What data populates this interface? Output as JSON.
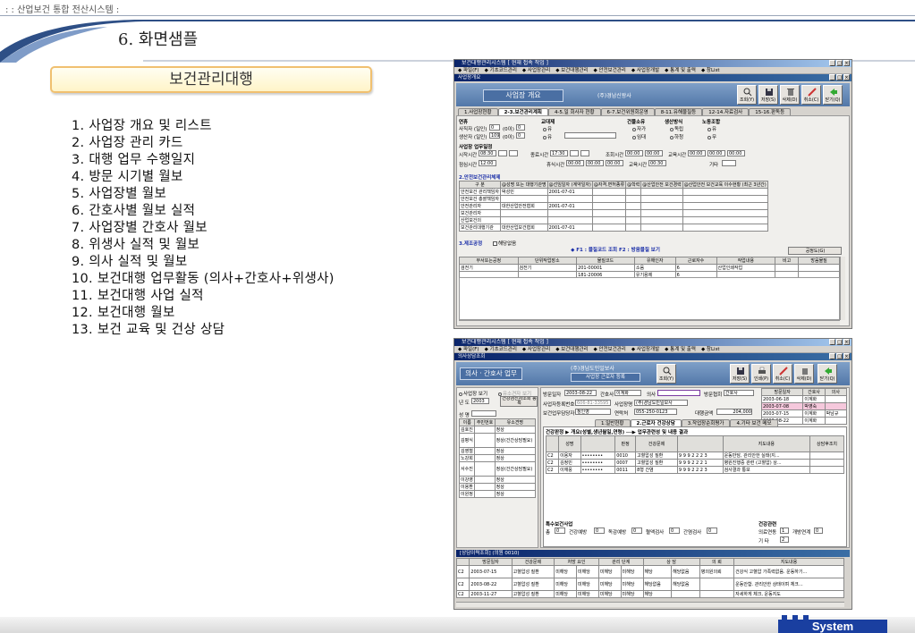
{
  "header": {
    "system_title": ": : 산업보건 통합 전산시스템 :",
    "page_title": "6. 화면샘플"
  },
  "section": {
    "title": "보건관리대행"
  },
  "toc": [
    "1. 사업장 개요 및 리스트",
    "2. 사업장 관리 카드",
    "3. 대행 업무 수행일지",
    "4. 방문 시기별 월보",
    "5. 사업장별 월보",
    "6. 간호사별 월보 실적",
    "7. 사업장별 간호사 월보",
    "8. 위생사 실적 및 월보",
    "9. 의사 실적 및 월보",
    "10. 보건대행 업무활동 (의사+간호사+위생사)",
    "11. 보건대행 사업 실적",
    "12. 보건대행 월보",
    "13. 보건 교육 및 건상 상담"
  ],
  "footer": {
    "logo_text": "System"
  },
  "window1": {
    "title": "보건대행관리시스템 [ 현재 접속 작업 ]",
    "menu": [
      "◆ 파일(F)",
      "◆ 기초코드관리",
      "◆ 사업장관리",
      "◆ 보건대행관리",
      "◆ 안전보건관리",
      "◆ 사업장개발",
      "◆ 통계 및 출력",
      "◆ 창List"
    ],
    "subwindow_title": "사업장개요",
    "header_title": "사업장 개요",
    "company": "(주)경남신왕사",
    "buttons": [
      "조회(Y)",
      "저장(S)",
      "삭제(D)",
      "취소(C)",
      "닫기(Q)"
    ],
    "tabs": [
      "1.사업장현황",
      "2-3.보건관리계획",
      "4-5.일 회사자 현황",
      "6-7.보건위원회운영",
      "8-11.유해물질등",
      "12-14.자료검사",
      "15-16.판독등"
    ],
    "active_tab": "2-3.보건관리계획",
    "sec_yeonhyu": "연휴",
    "sec_gyodae": "교대제",
    "sec_geonmul": "건물소유",
    "sec_saengsan": "생산방식",
    "sec_nojo": "노동조합",
    "row_saryeon": "사직자 (일인)",
    "row_saengsan": "생산자 (일인)",
    "val_saryeon": "0",
    "val_saengsan": "109",
    "unit": "(0이)",
    "unit_val": "0",
    "gyodae_opts": [
      "유",
      "유"
    ],
    "geonmul_opts": [
      "자가",
      "임대"
    ],
    "saengsan_opts": [
      "독립",
      "하청"
    ],
    "nojo_opts": [
      "유",
      "무"
    ],
    "work_time_title": "사업장 업무일정",
    "time_labels": [
      "시작시간",
      "종료시간",
      "조회시간",
      "교육시간",
      "점심시간",
      "휴식시간",
      "교육시간",
      "기타"
    ],
    "time_values": [
      "08:30",
      "17:30",
      "00:00",
      "00:00",
      "12:00",
      "00:00",
      "00:30"
    ],
    "mgmt_title": "2.안전보건관리체제",
    "mgmt_headers": [
      "구 분",
      "@성명 또는 대행기관명",
      "@선임일자 (계약일자)",
      "@자격.면허종류",
      "@학력",
      "@산업안전 보건경력",
      "@산업안전 보건교육 이수현황 (최근 3년간)",
      "교육과정명",
      "교육기간"
    ],
    "mgmt_rows": [
      [
        "안전보건 관리책임자",
        "박성민",
        "2001-07-01"
      ],
      [
        "안전보건 총괄책임자",
        "",
        ""
      ],
      [
        "안전관리자",
        "대한산업안전협회",
        "2001-07-01"
      ],
      [
        "보건관리자",
        "",
        ""
      ],
      [
        "산업보건의",
        "",
        ""
      ],
      [
        "보건관리대행기관",
        "대한산업보건협회",
        "2001-07-01"
      ]
    ],
    "process_title": "3.제조공정",
    "process_check": "해당없음",
    "process_bar": "◆ F1 : 물질코드 조회   F2 : 방음물질 보기",
    "process_btn": "공정도(G)",
    "proc_headers": [
      "부서또는공정",
      "단위작업장소",
      "물질코드",
      "유해인자",
      "근로자수",
      "작업내용",
      "비고",
      "방음물질"
    ],
    "proc_rows": [
      [
        "검전기",
        "검전기",
        "201-00001",
        "소음",
        "6",
        "산업인쇄작업"
      ],
      [
        "",
        "",
        "181-20006",
        "유기용제",
        "6",
        ""
      ]
    ]
  },
  "window2": {
    "title": "보건대행관리시스템 [ 현재 접속 작업 ]",
    "menu": [
      "◆ 파일(F)",
      "◆ 기초코드관리",
      "◆ 사업장관리",
      "◆ 보건대행관리",
      "◆ 안전보건관리",
      "◆ 사업장개발",
      "◆ 통계 및 출력",
      "◆ 창List"
    ],
    "subwindow_title": "의사상담조회",
    "header_title": "의사 · 간호사 업무",
    "company": "(주)경남도민일보사",
    "sub_header": "사업장 근로자 등록",
    "buttons": [
      "조회(Y)",
      "저장(S)",
      "인쇄(P)",
      "취소(C)",
      "삭제(D)",
      "닫기(Q)"
    ],
    "left_opts": [
      "사업장 보기",
      "유소견자 보기"
    ],
    "year_label": "년 도",
    "year_val": "2003",
    "check_btn": "건강검진자조회 등록",
    "name_label": "성 명",
    "left_headers": [
      "이름",
      "주민번호",
      "유소견명"
    ],
    "left_rows": [
      [
        "김호진",
        "정상"
      ],
      [
        "김평식",
        "정상(건간상담필요)"
      ],
      [
        "김영철",
        "정상"
      ],
      [
        "노강희",
        "정상"
      ],
      [
        "서수진",
        "정상(건간상담필요)"
      ],
      [
        "이강영",
        "정상"
      ],
      [
        "이용환",
        "정상"
      ],
      [
        "이원정",
        "정상"
      ]
    ],
    "visit_date_label": "방문일자",
    "visit_date": "2003-08-22",
    "nurse_label": "간호사",
    "nurse": "이계화",
    "doctor_label": "의사",
    "visitor_label": "방문협회",
    "visitor": "간호사",
    "biz_no_label": "사업자등록번호",
    "biz_no": "606-81-33595",
    "company_label": "사업장명",
    "company_val": "(주)경남도민일보사",
    "manager_label": "보건업무담당자",
    "manager": "정인영",
    "phone_label": "연락처",
    "phone": "055-250-0123",
    "count_label": "대행금액",
    "count": "204,000",
    "right_headers": [
      "방문일자",
      "간호사",
      "의사"
    ],
    "right_rows": [
      [
        "2003-06-18",
        "이계화",
        ""
      ],
      [
        "2003-07-08",
        "박영숙",
        ""
      ],
      [
        "2003-07-15",
        "이계화",
        "박남규"
      ],
      [
        "2003-08-22",
        "이계화",
        ""
      ]
    ],
    "tabs": [
      "1.일반현황",
      "2.근로자 건강상담",
      "3.작업장순회평가",
      "4.기타 보건 메모"
    ],
    "active_tab": "2.근로자 건강상담",
    "inner_bar": "건강판정  ▶ 개요(성별,생년월일,연령) ──▶ 업무관련성 및 내용 결과",
    "consult_headers": [
      "성명",
      "판정",
      "건강문제",
      "지도내용",
      "상담후조치"
    ],
    "consult_rows": [
      [
        "C2",
        "이용자",
        "0010",
        "고혈압성 질환",
        "운동만담, 관리안한 실태(지..."
      ],
      [
        "C2",
        "김정민",
        "0007",
        "고혈압성 질환",
        "병원진행중 관련 (고혈압) 상..."
      ],
      [
        "C2",
        "이재웅",
        "0011",
        "8형 간염",
        "검사결과 통보"
      ]
    ],
    "special_label": "특수보건사업",
    "special_fields": [
      "총",
      "건강예방",
      "독감예방",
      "혈액검사",
      "간염검사"
    ],
    "special_vals": [
      "0",
      "0",
      "0",
      "0",
      "0"
    ],
    "health_label": "건강관련",
    "health_fields": [
      "의료연동",
      "개방연계",
      "기 타"
    ],
    "health_vals": [
      "1",
      "0",
      "2"
    ],
    "bottom_title": "[상담이력조회] (의원 0010)",
    "bottom_headers": [
      "방문일자",
      "건강문제",
      "처방 요인",
      "관리 단계",
      "상 담",
      "의 뢰",
      "지도내용"
    ],
    "bottom_rows": [
      [
        "C2",
        "2003-07-15",
        "고혈압성 질환",
        "미해당",
        "미해당",
        "미해당",
        "미해당",
        "해당",
        "해당없음",
        "해당없음",
        "병의원의뢰",
        "건강식 고혈압 가족력없음. 운동하기..."
      ],
      [
        "C2",
        "2003-08-22",
        "고혈압성 질환",
        "미해당",
        "미해당",
        "미해당",
        "미해당",
        "해당없음",
        "해당없음",
        "해당없음",
        "",
        "운동안함. 관리안한 상태이며 체크..."
      ],
      [
        "C2",
        "2003-11-27",
        "고혈압성 질환",
        "미해당",
        "미해당",
        "미해당",
        "미해당",
        "해당",
        "",
        "",
        "",
        "자세하게 체크, 운동지도"
      ]
    ]
  },
  "colors": {
    "accent_navy": "#0a246a",
    "header_blue": "#5277a8",
    "logo_blue": "#1a3fa0",
    "section_border": "#f0c070"
  }
}
